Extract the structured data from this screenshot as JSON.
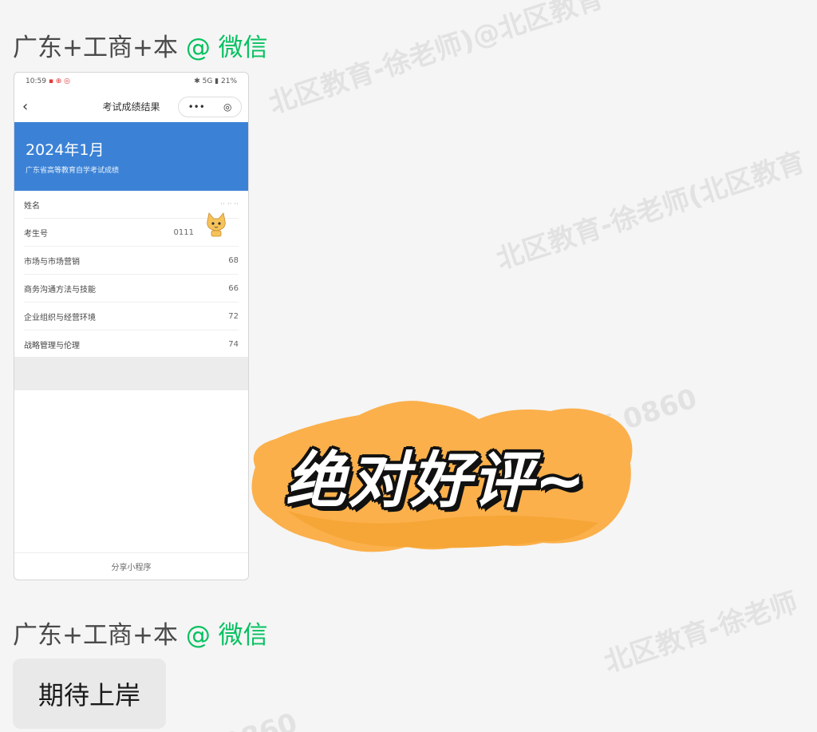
{
  "watermarks": [
    "北区教育-徐老师)@北区教育",
    "北区教育-徐老师(北区教育",
    "育 0860",
    "北区教育-徐老师",
    "0860"
  ],
  "messages": [
    {
      "sender": "广东+工商+本",
      "at": "@",
      "platform": "微信"
    },
    {
      "sender": "广东+工商+本",
      "at": "@",
      "platform": "微信",
      "text": "期待上岸"
    }
  ],
  "phone": {
    "status_time": "10:59",
    "status_icons": "▪ ⊕ ◎",
    "status_right": "✱ 5G ▮ 21%",
    "nav_title": "考试成绩结果",
    "back_icon": "‹",
    "capsule_more": "•••",
    "capsule_close": "◎",
    "banner_date": "2024年1月",
    "banner_sub": "广东省高等教育自学考试成绩",
    "rows": [
      {
        "label": "姓名",
        "value": "·· ·· ··"
      },
      {
        "label": "考生号",
        "value": "0111"
      },
      {
        "label": "市场与市场营销",
        "value": "68"
      },
      {
        "label": "商务沟通方法与技能",
        "value": "66"
      },
      {
        "label": "企业组织与经营环境",
        "value": "72"
      },
      {
        "label": "战略管理与伦理",
        "value": "74"
      }
    ],
    "share_label": "分享小程序"
  },
  "sticker_text": "绝对好评~",
  "colors": {
    "accent": "#07c160",
    "banner_blue": "#3b82d6",
    "sticker_orange": "#fbb04b"
  }
}
